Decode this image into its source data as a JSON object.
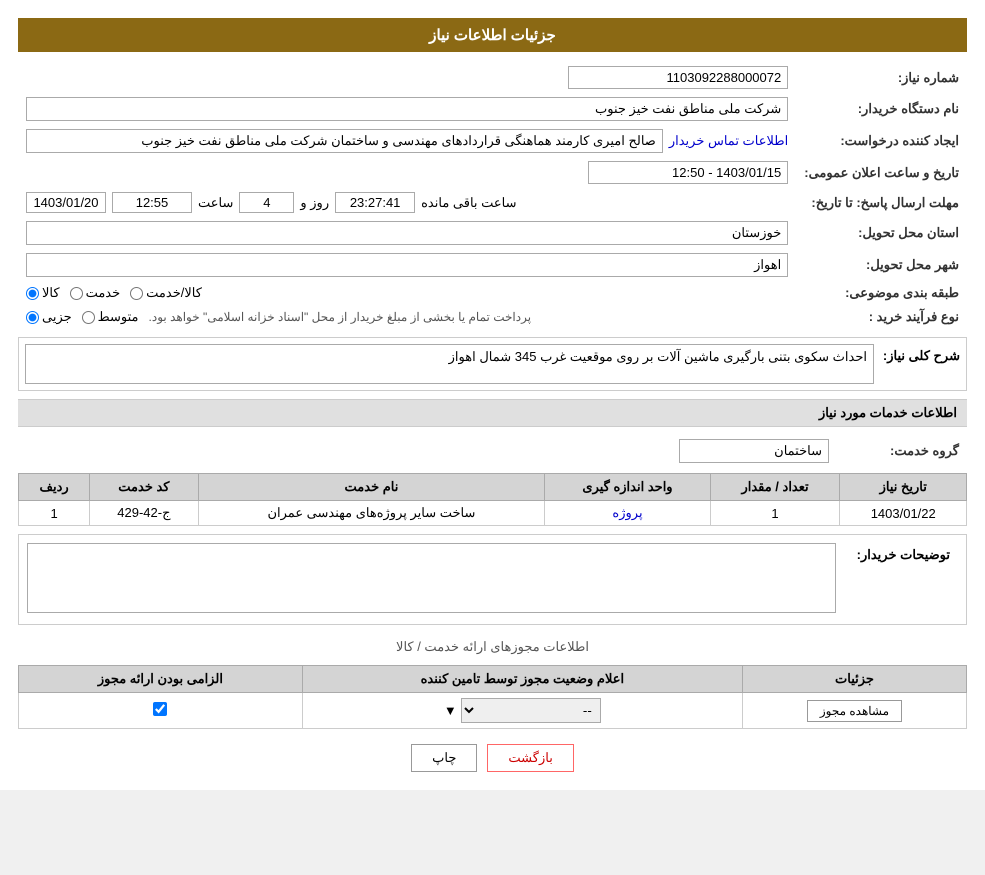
{
  "header": {
    "title": "جزئیات اطلاعات نیاز"
  },
  "fields": {
    "shomara_niaz_label": "شماره نیاز:",
    "shomara_niaz_value": "1103092288000072",
    "nam_dastgah_label": "نام دستگاه خریدار:",
    "nam_dastgah_value": "شرکت ملی مناطق نفت خیز جنوب",
    "idad_label": "ایجاد کننده درخواست:",
    "idad_value": "صالح امیری کارمند هماهنگی قراردادهای مهندسی و ساختمان شرکت ملی مناطق نفت خیز جنوب",
    "idad_link": "اطلاعات تماس خریدار",
    "tarikh_label": "تاریخ و ساعت اعلان عمومی:",
    "tarikh_value": "1403/01/15 - 12:50",
    "mohlat_label": "مهلت ارسال پاسخ: تا تاریخ:",
    "mohlat_date": "1403/01/20",
    "mohlat_saat": "12:55",
    "mohlat_roz": "4",
    "mohlat_time": "23:27:41",
    "mohlat_text": "ساعت باقی مانده",
    "ostan_label": "استان محل تحویل:",
    "ostan_value": "خوزستان",
    "shahr_label": "شهر محل تحویل:",
    "shahr_value": "اهواز",
    "tabaqe_label": "طبقه بندی موضوعی:",
    "tabaqe_kala": "کالا",
    "tabaqe_khedmat": "خدمت",
    "tabaqe_kala_khedmat": "کالا/خدمت",
    "noue_farayand_label": "نوع فرآیند خرید :",
    "noue_jozi": "جزیی",
    "noue_motavaset": "متوسط",
    "noue_text": "پرداخت تمام یا بخشی از مبلغ خریدار از محل \"اسناد خزانه اسلامی\" خواهد بود.",
    "sharh_label": "شرح کلی نیاز:",
    "sharh_value": "احداث سکوی بتنی بارگیری ماشین آلات بر روی موقعیت غرب 345 شمال اهواز",
    "services_section": "اطلاعات خدمات مورد نیاز",
    "group_label": "گروه خدمت:",
    "group_value": "ساختمان",
    "table_headers": {
      "radif": "ردیف",
      "code": "کد خدمت",
      "name": "نام خدمت",
      "vahed": "واحد اندازه گیری",
      "tedad": "تعداد / مقدار",
      "tarikh": "تاریخ نیاز"
    },
    "table_row": {
      "radif": "1",
      "code": "ج-42-429",
      "name": "ساخت سایر پروژه‌های مهندسی عمران",
      "vahed": "پروژه",
      "tedad": "1",
      "tarikh": "1403/01/22"
    },
    "description_label": "توضیحات خریدار:",
    "permits_title": "اطلاعات مجوزهای ارائه خدمت / کالا",
    "permits_table_headers": {
      "elzam": "الزامی بودن ارائه مجوز",
      "ealam": "اعلام وضعیت مجوز توسط تامین کننده",
      "joziyat": "جزئیات"
    },
    "permits_row": {
      "elzam_checked": true,
      "ealam_value": "--",
      "joziyat_btn": "مشاهده مجوز"
    },
    "buttons": {
      "print": "چاپ",
      "back": "بازگشت"
    }
  }
}
